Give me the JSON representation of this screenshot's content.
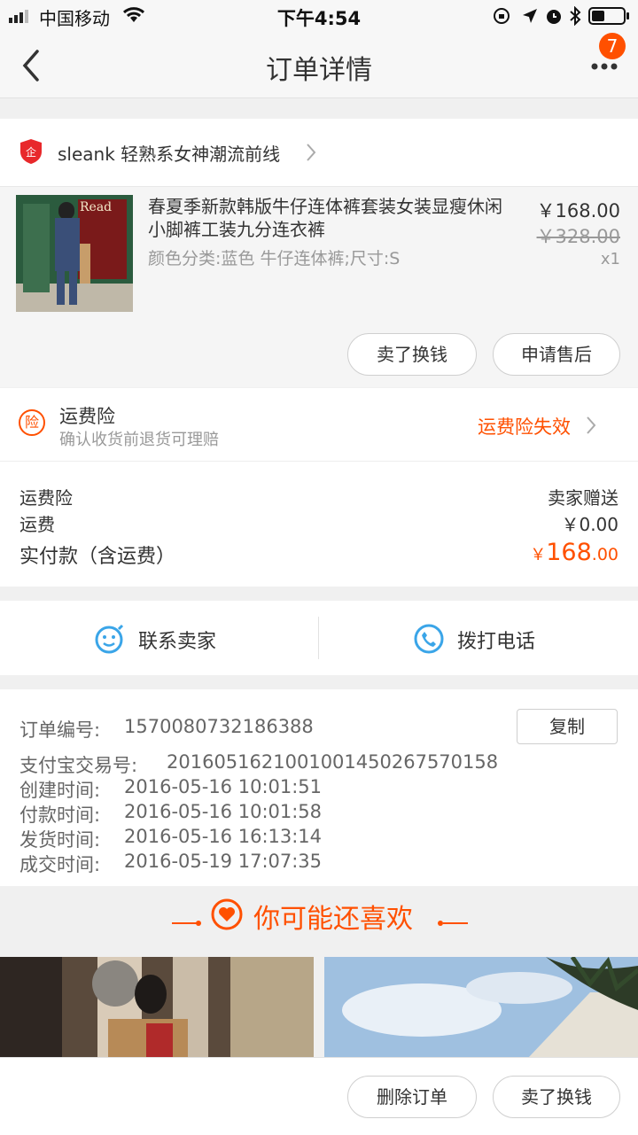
{
  "status_bar": {
    "carrier": "中国移动",
    "time": "下午4:54"
  },
  "nav": {
    "title": "订单详情",
    "badge": "7",
    "back_icon": "chevron-left-icon",
    "more_icon": "more-dots-icon"
  },
  "shop": {
    "name": "sleank 轻熟系女神潮流前线"
  },
  "product": {
    "title": "春夏季新款韩版牛仔连体裤套装女装显瘦休闲小脚裤工装九分连衣裤",
    "sku": "颜色分类:蓝色 牛仔连体裤;尺寸:S",
    "price": "￥168.00",
    "original_price": "￥328.00",
    "quantity": "x1",
    "thumb_text": "Read"
  },
  "product_actions": {
    "sell_label": "卖了换钱",
    "after_sale_label": "申请售后"
  },
  "insurance": {
    "icon_char": "险",
    "title": "运费险",
    "subtitle": "确认收货前退货可理赔",
    "status": "运费险失效"
  },
  "summary": {
    "rows": [
      {
        "label": "运费险",
        "value": "卖家赠送"
      },
      {
        "label": "运费",
        "value": "￥0.00"
      }
    ],
    "total_label": "实付款（含运费）",
    "total_currency": "￥",
    "total_int": "168",
    "total_dec": ".00"
  },
  "contact": {
    "seller_label": "联系卖家",
    "call_label": "拨打电话"
  },
  "order_info": {
    "copy_label": "复制",
    "rows": [
      {
        "label": "订单编号:",
        "value": "1570080732186388"
      },
      {
        "label": "支付宝交易号:",
        "value": "2016051621001001450267570158"
      },
      {
        "label": "创建时间:",
        "value": "2016-05-16 10:01:51"
      },
      {
        "label": "付款时间:",
        "value": "2016-05-16 10:01:58"
      },
      {
        "label": "发货时间:",
        "value": "2016-05-16 16:13:14"
      },
      {
        "label": "成交时间:",
        "value": "2016-05-19 17:07:35"
      }
    ]
  },
  "recommend": {
    "title": "你可能还喜欢"
  },
  "bottom_bar": {
    "delete_label": "删除订单",
    "sell_label": "卖了换钱"
  },
  "colors": {
    "accent": "#ff5000",
    "blue_icon": "#3aa5e8"
  }
}
